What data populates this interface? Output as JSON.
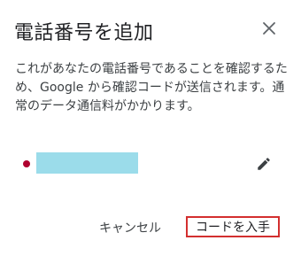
{
  "dialog": {
    "title": "電話番号を追加",
    "description": "これがあなたの電話番号であることを確認するため、Google から確認コードが送信されます。通常のデータ通信料がかかります。",
    "phone": {
      "value_redacted": true
    },
    "actions": {
      "cancel_label": "キャンセル",
      "get_code_label": "コードを入手"
    },
    "icons": {
      "close": "close-icon",
      "edit": "pencil-icon",
      "flag": "country-flag-icon"
    },
    "colors": {
      "highlight_border": "#d32f2f",
      "redaction": "#9bdcea",
      "flag_dot": "#b0002f"
    }
  }
}
